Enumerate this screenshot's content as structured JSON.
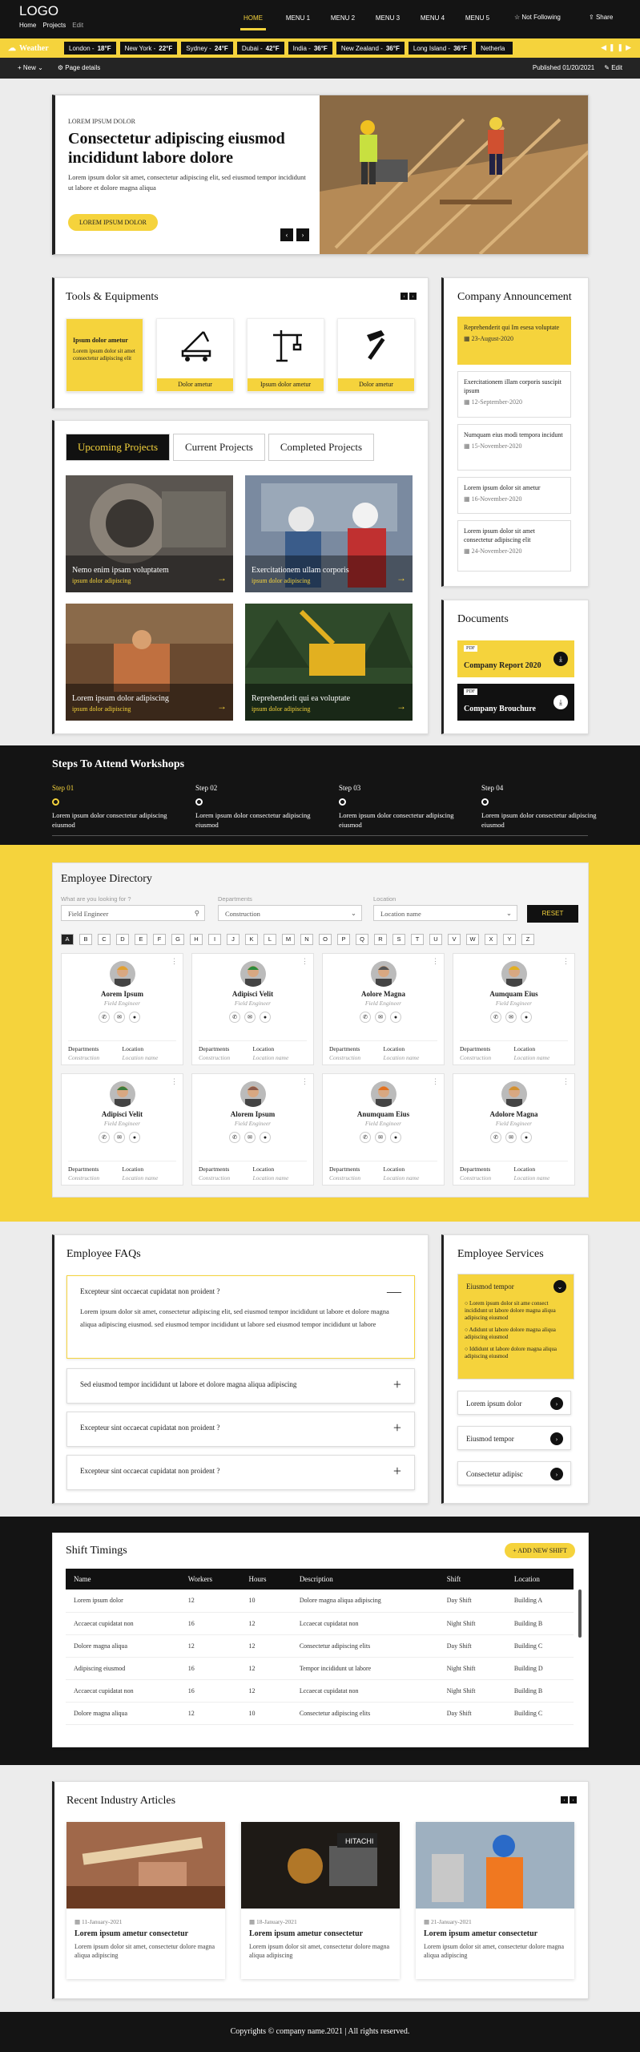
{
  "header": {
    "logo": "LOGO",
    "links": [
      "Home",
      "Projects",
      "Edit"
    ],
    "nav": [
      "HOME",
      "MENU 1",
      "MENU 2",
      "MENU 3",
      "MENU 4",
      "MENU 5"
    ],
    "not_following": "Not Following",
    "share": "Share"
  },
  "weather": {
    "label": "Weather",
    "items": [
      {
        "city": "London -",
        "temp": "18°F"
      },
      {
        "city": "New York -",
        "temp": "22°F"
      },
      {
        "city": "Sydney -",
        "temp": "24°F"
      },
      {
        "city": "Dubai -",
        "temp": "42°F"
      },
      {
        "city": "India -",
        "temp": "36°F"
      },
      {
        "city": "New Zealand -",
        "temp": "36°F"
      },
      {
        "city": "Long Island -",
        "temp": "36°F"
      },
      {
        "city": "Netherla",
        "temp": ""
      }
    ]
  },
  "pagebar": {
    "new": "New",
    "details": "Page details",
    "published": "Published 01/20/2021",
    "edit": "Edit"
  },
  "hero": {
    "eyebrow": "LOREM IPSUM DOLOR",
    "title": "Consectetur adipiscing eiusmod incididunt labore dolore",
    "text": "Lorem ipsum dolor sit amet, consectetur adipiscing elit, sed eiusmod tempor incididunt ut labore et dolore magna aliqua",
    "button": "LOREM IPSUM DOLOR"
  },
  "tools": {
    "title": "Tools & Equipments",
    "first_title": "Ipsum dolor ametur",
    "first_text": "Lorem ipsum dolor sit amet consectetur adipiscing elit",
    "items": [
      "Dolor ametur",
      "Ipsum dolor ametur",
      "Dolor ametur"
    ]
  },
  "announce": {
    "title": "Company Announcement",
    "items": [
      {
        "t": "Reprehenderit qui Im esesa voluptate",
        "d": "23-August-2020"
      },
      {
        "t": "Exercitationem illam corporis suscipit ipsum",
        "d": "12-September-2020"
      },
      {
        "t": "Numquam eius modi tempora incidunt",
        "d": "15-November-2020"
      },
      {
        "t": "Lorem ipsum dolor sit ametur",
        "d": "16-November-2020"
      },
      {
        "t": "Lorem ipsum dolor sit amet consectetur adipiscing elit",
        "d": "24-November-2020"
      }
    ]
  },
  "projects": {
    "tabs": [
      "Upcoming Projects",
      "Current Projects",
      "Completed Projects"
    ],
    "items": [
      {
        "t": "Nemo enim ipsam voluptatem",
        "s": "ipsum dolor adipiscing"
      },
      {
        "t": "Exercitationem ullam corporis",
        "s": "ipsum dolor adipiscing"
      },
      {
        "t": "Lorem ipsum dolor adipiscing",
        "s": "ipsum dolor adipiscing"
      },
      {
        "t": "Reprehenderit qui ea voluptate",
        "s": "ipsum dolor adipiscing"
      }
    ]
  },
  "documents": {
    "title": "Documents",
    "items": [
      {
        "tag": "PDF",
        "name": "Company Report 2020"
      },
      {
        "tag": "PDF",
        "name": "Company Brouchure"
      }
    ]
  },
  "steps": {
    "title": "Steps To Attend Workshops",
    "items": [
      {
        "n": "Step 01",
        "t": "Lorem ipsum dolor consectetur adipiscing eiusmod"
      },
      {
        "n": "Step 02",
        "t": "Lorem ipsum dolor consectetur adipiscing eiusmod"
      },
      {
        "n": "Step 03",
        "t": "Lorem ipsum dolor consectetur adipiscing eiusmod"
      },
      {
        "n": "Step 04",
        "t": "Lorem ipsum dolor consectetur adipiscing eiusmod"
      }
    ]
  },
  "directory": {
    "title": "Employee Directory",
    "search_label": "What are you looking for ?",
    "search_value": "Field Engineer",
    "dept_label": "Departments",
    "dept_value": "Construction",
    "loc_label": "Location",
    "loc_value": "Location name",
    "reset": "RESET",
    "letters": [
      "A",
      "B",
      "C",
      "D",
      "E",
      "F",
      "G",
      "H",
      "I",
      "J",
      "K",
      "L",
      "M",
      "N",
      "O",
      "P",
      "Q",
      "R",
      "S",
      "T",
      "U",
      "V",
      "W",
      "X",
      "Y",
      "Z"
    ],
    "dept_h": "Departments",
    "loc_h": "Location",
    "dept_v": "Construction",
    "loc_v": "Location name",
    "employees": [
      {
        "n": "Aorem Ipsum",
        "r": "Field Engineer"
      },
      {
        "n": "Adipisci Velit",
        "r": "Field Engineer"
      },
      {
        "n": "Aolore Magna",
        "r": "Field Engineer"
      },
      {
        "n": "Aumquam Eius",
        "r": "Field Engineer"
      },
      {
        "n": "Adipisci Velit",
        "r": "Field Engineer"
      },
      {
        "n": "Alorem Ipsum",
        "r": "Field Engineer"
      },
      {
        "n": "Anumquam Eius",
        "r": "Field Engineer"
      },
      {
        "n": "Adolore Magna",
        "r": "Field Engineer"
      }
    ]
  },
  "faq": {
    "title": "Employee FAQs",
    "items": [
      {
        "q": "Excepteur sint occaecat cupidatat non proident ?",
        "a": "Lorem ipsum dolor sit amet, consectetur adipiscing elit, sed eiusmod tempor incididunt ut labore et dolore magna aliqua adipiscing eiusmod. sed eiusmod tempor incididunt ut labore sed eiusmod tempor incididunt ut labore"
      },
      {
        "q": "Sed eiusmod tempor incididunt ut labore et dolore magna aliqua adipiscing"
      },
      {
        "q": "Excepteur sint occaecat cupidatat non proident ?"
      },
      {
        "q": "Excepteur sint occaecat cupidatat non proident ?"
      }
    ]
  },
  "services": {
    "title": "Employee Services",
    "open": "Eiusmod tempor",
    "open_items": [
      "Lorem ipsum dolor sit ame consect incididunt ut labore dolore magna aliqua adipiscing eiusmod",
      "Adidunt ut labore dolore magna aliqua adipiscing eiusmod",
      "Iddidunt ut labore dolore magna aliqua adipiscing eiusmod"
    ],
    "items": [
      "Lorem ipsum dolor",
      "Eiusmod tempor",
      "Consectetur adipisc"
    ]
  },
  "shift": {
    "title": "Shift Timings",
    "add": "ADD NEW SHIFT",
    "cols": [
      "Name",
      "Workers",
      "Hours",
      "Description",
      "Shift",
      "Location"
    ],
    "rows": [
      [
        "Lorem ipsum dolor",
        "12",
        "10",
        "Dolore magna aliqua adipiscing",
        "Day Shift",
        "Building A"
      ],
      [
        "Accaecat cupidatat non",
        "16",
        "12",
        "Lccaecat cupidatat non",
        "Night Shift",
        "Building B"
      ],
      [
        "Dolore magna aliqua",
        "12",
        "12",
        "Consectetur adipiscing elits",
        "Day Shift",
        "Building C"
      ],
      [
        "Adipiscing eiusmod",
        "16",
        "12",
        "Tempor incididunt ut labore",
        "Night Shift",
        "Building D"
      ],
      [
        "Accaecat cupidatat non",
        "16",
        "12",
        "Lccaecat cupidatat non",
        "Night Shift",
        "Building B"
      ],
      [
        "Dolore magna aliqua",
        "12",
        "10",
        "Consectetur adipiscing elits",
        "Day Shift",
        "Building C"
      ]
    ]
  },
  "articles": {
    "title": "Recent Industry Articles",
    "items": [
      {
        "d": "11-January-2021",
        "t": "Lorem ipsum ametur consectetur",
        "s": "Lorem ipsum dolor sit amet, consectetur dolore magna aliqua adipiscing"
      },
      {
        "d": "18-January-2021",
        "t": "Lorem ipsum ametur consectetur",
        "s": "Lorem ipsum dolor sit amet, consectetur dolore magna aliqua adipiscing"
      },
      {
        "d": "21-January-2021",
        "t": "Lorem ipsum ametur consectetur",
        "s": "Lorem ipsum dolor sit amet, consectetur dolore magna aliqua adipiscing"
      }
    ]
  },
  "footer": {
    "text": "Copyrights © company name.2021 | All rights reserved."
  },
  "colors": {
    "accent": "#f5d33c",
    "dark": "#141414"
  }
}
